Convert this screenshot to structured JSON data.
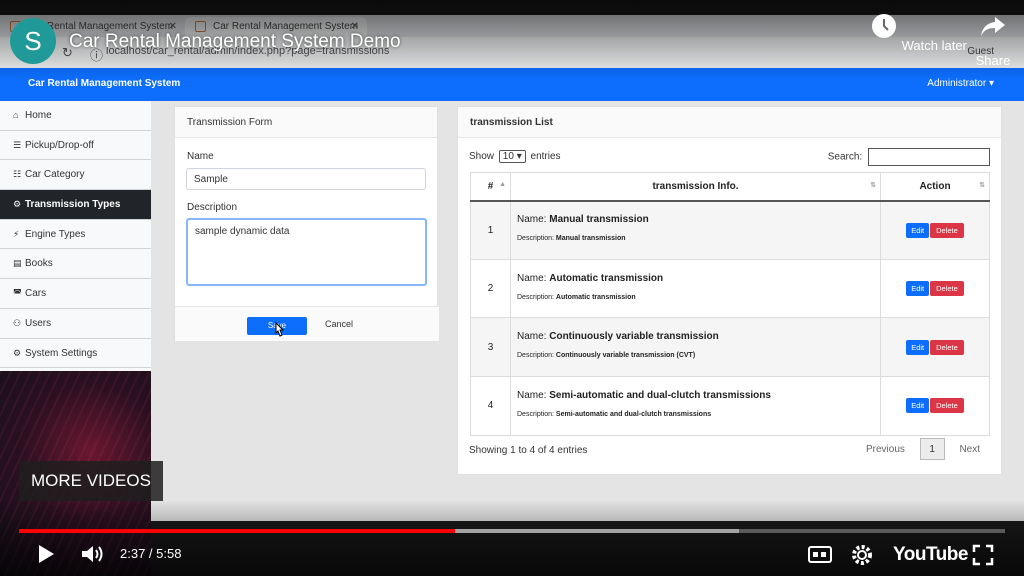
{
  "browser": {
    "tabs": [
      {
        "label": "Car Rental Management System"
      },
      {
        "label": "Car Rental Management System"
      }
    ],
    "url": "localhost/car_rental/admin/index.php?page=transmissions",
    "profile": "Guest"
  },
  "video": {
    "channel_initial": "S",
    "title": "Car Rental Management System Demo",
    "watch_later": "Watch later",
    "share": "Share",
    "more_videos": "MORE VIDEOS",
    "time": "2:37 / 5:58",
    "played_fraction": 0.442,
    "buffered_fraction": 0.73,
    "brand": "YouTube"
  },
  "app": {
    "brand": "Car Rental Management System",
    "user": "Administrator",
    "primary_color": "#0d6efd",
    "sidebar": [
      {
        "icon": "home-icon",
        "glyph": "⌂",
        "label": "Home",
        "active": false
      },
      {
        "icon": "list-icon",
        "glyph": "☰",
        "label": "Pickup/Drop-off",
        "active": false
      },
      {
        "icon": "list-ul-icon",
        "glyph": "☷",
        "label": "Car Category",
        "active": false
      },
      {
        "icon": "gear-icon",
        "glyph": "⚙",
        "label": "Transmission Types",
        "active": true
      },
      {
        "icon": "bolt-icon",
        "glyph": "⚡",
        "label": "Engine Types",
        "active": false
      },
      {
        "icon": "book-icon",
        "glyph": "▤",
        "label": "Books",
        "active": false
      },
      {
        "icon": "car-icon",
        "glyph": "◚",
        "label": "Cars",
        "active": false
      },
      {
        "icon": "users-icon",
        "glyph": "⚇",
        "label": "Users",
        "active": false
      },
      {
        "icon": "cogs-icon",
        "glyph": "⚙",
        "label": "System Settings",
        "active": false
      }
    ],
    "form": {
      "title": "Transmission Form",
      "name_label": "Name",
      "name_value": "Sample",
      "desc_label": "Description",
      "desc_value": "sample dynamic data",
      "save": "Save",
      "cancel": "Cancel"
    },
    "list": {
      "title": "transmission List",
      "show": "Show",
      "entries_count": "10",
      "entries": "entries",
      "search_label": "Search:",
      "columns": [
        "#",
        "transmission Info.",
        "Action"
      ],
      "name_prefix": "Name:",
      "desc_prefix": "Description:",
      "edit": "Edit",
      "delete": "Delete",
      "rows": [
        {
          "num": "1",
          "name": "Manual transmission",
          "description": "Manual transmission"
        },
        {
          "num": "2",
          "name": "Automatic transmission",
          "description": "Automatic transmission"
        },
        {
          "num": "3",
          "name": "Continuously variable transmission",
          "description": "Continuously variable transmission (CVT)"
        },
        {
          "num": "4",
          "name": "Semi-automatic and dual-clutch transmissions",
          "description": "Semi-automatic and dual-clutch transmissions"
        }
      ],
      "showing": "Showing 1 to 4 of 4 entries",
      "previous": "Previous",
      "page": "1",
      "next": "Next"
    }
  }
}
